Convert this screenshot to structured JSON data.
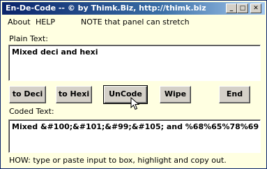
{
  "window": {
    "title": "En-De-Code -- © by Thimk.Biz, http://thimk.biz",
    "controls": {
      "minimize": "_",
      "maximize": "□",
      "close": "✕"
    }
  },
  "menu": {
    "about": "About",
    "help": "HELP",
    "note": "NOTE that panel can stretch"
  },
  "plain": {
    "label": "Plain Text:",
    "value": "Mixed deci and hexi"
  },
  "buttons": {
    "to_deci": "to Deci",
    "to_hexi": "to Hexi",
    "uncode": "UnCode",
    "wipe": "Wipe",
    "end": "End"
  },
  "coded": {
    "label": "Coded Text:",
    "value": "Mixed &#100;&#101;&#99;&#105; and %68%65%78%69"
  },
  "footer": {
    "howto": "HOW: type or paste input to box, highlight and copy out."
  },
  "colors": {
    "window_bg": "#ffffe1",
    "titlebar_start": "#0a246a",
    "titlebar_end": "#a6caf0",
    "button_face": "#d4d0c8"
  },
  "icons": {
    "cursor": "mouse-pointer-icon"
  }
}
